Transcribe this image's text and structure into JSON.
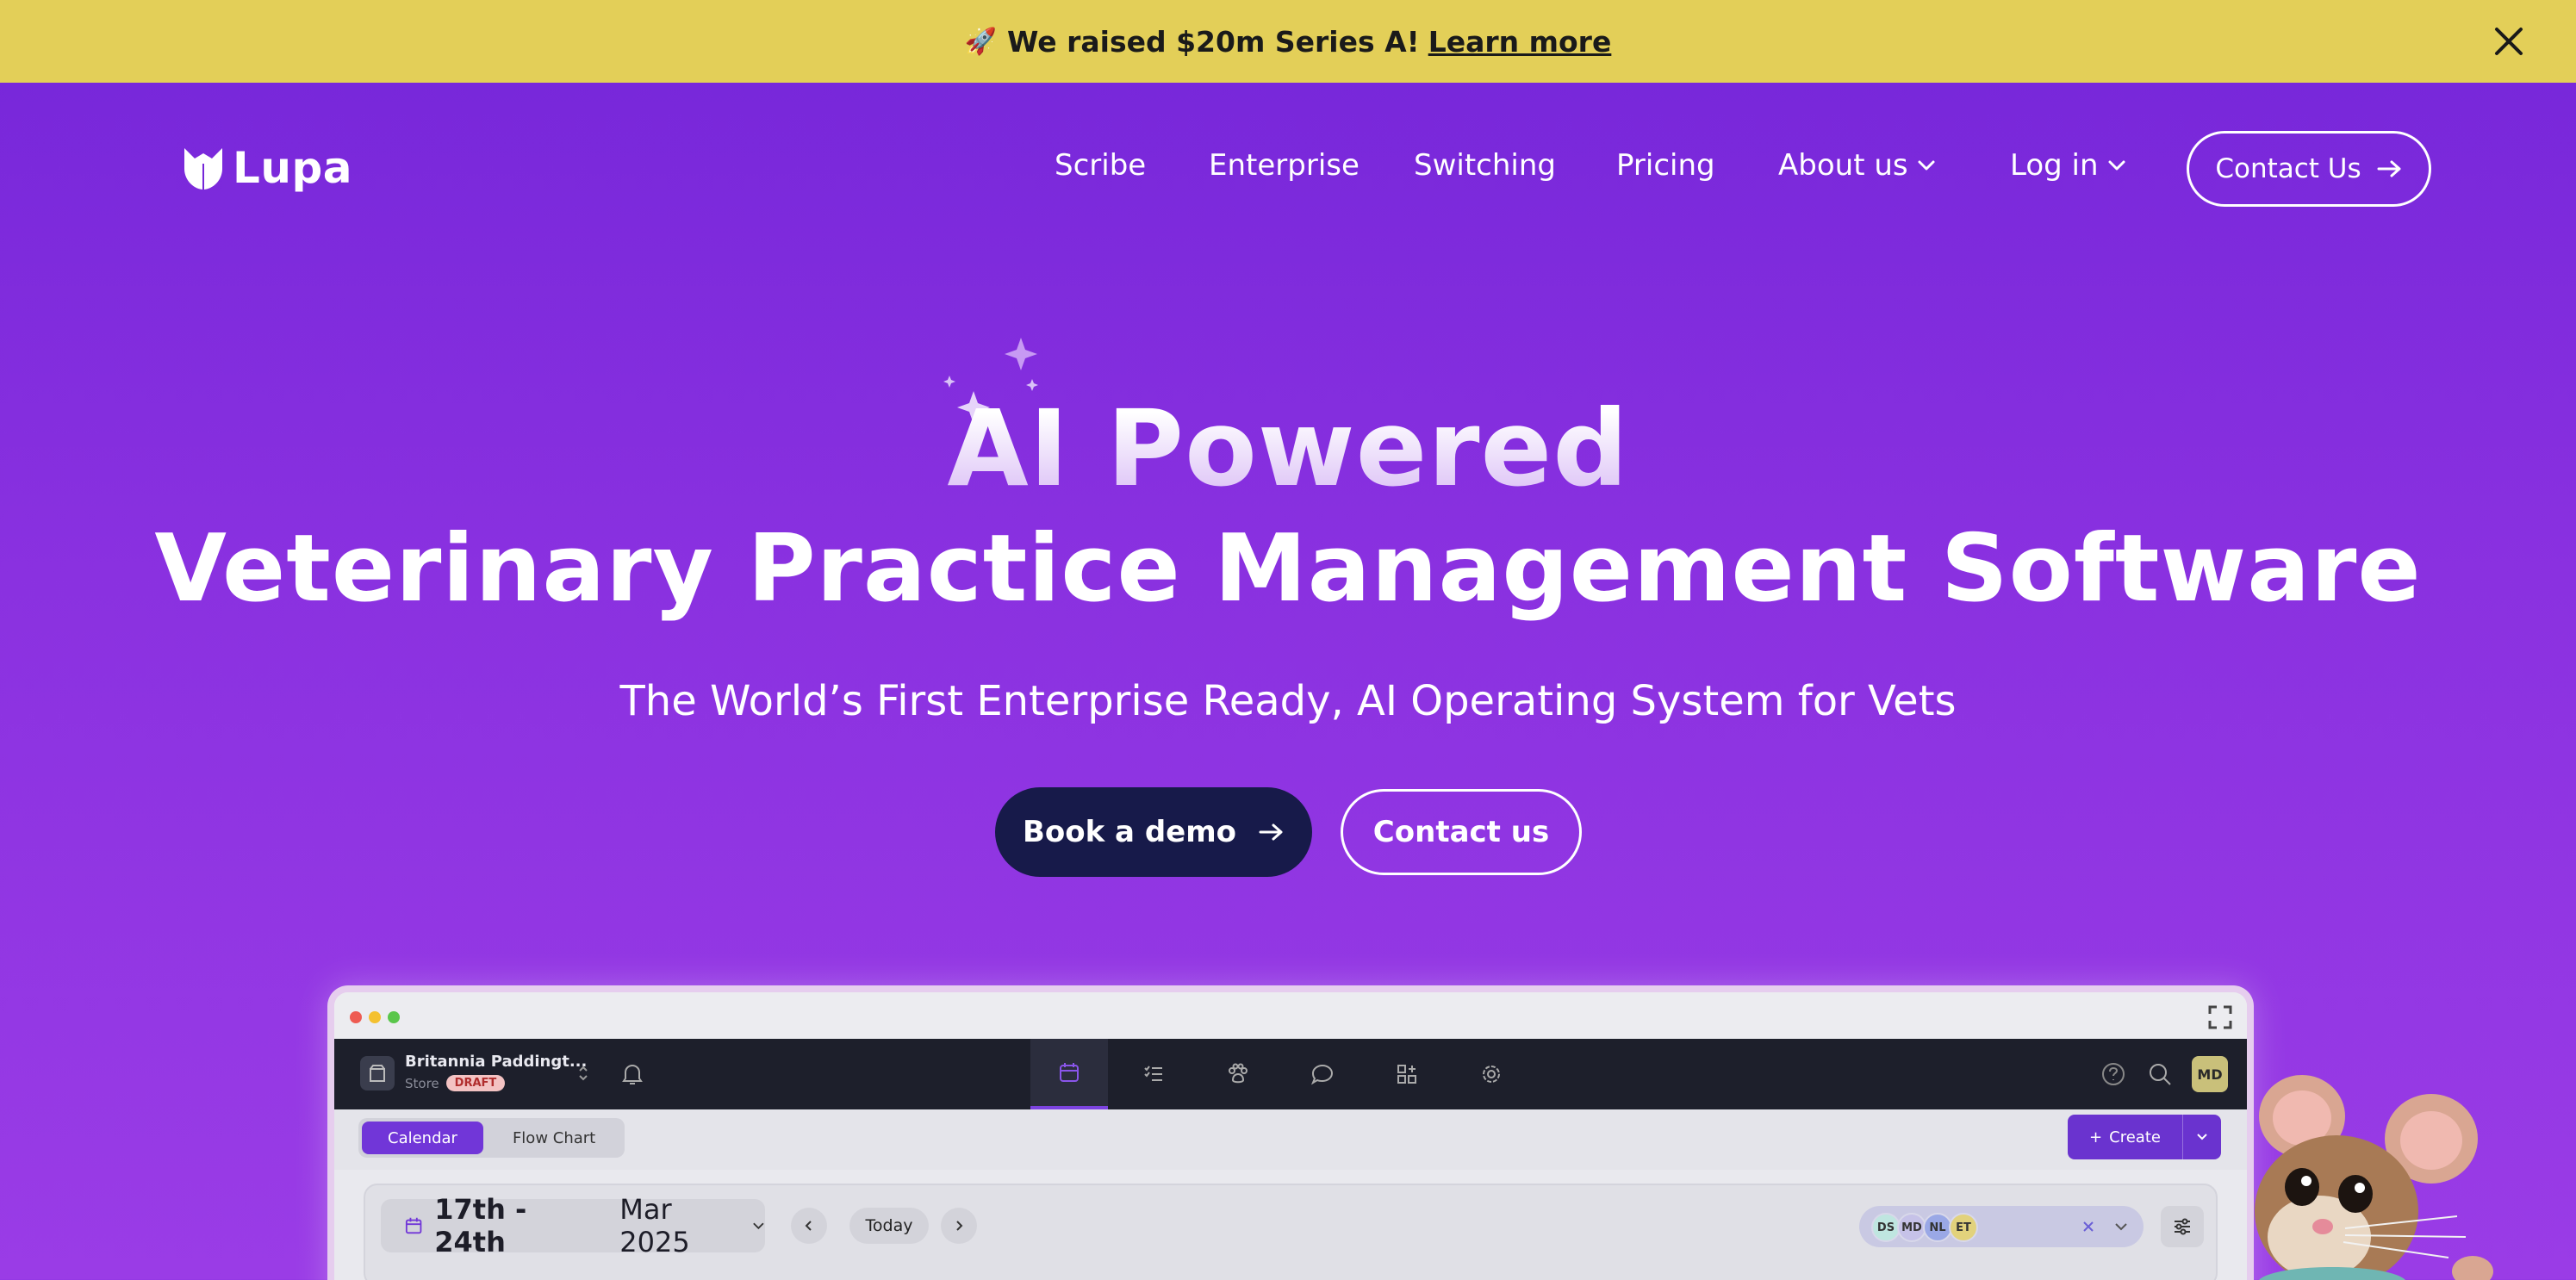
{
  "banner": {
    "emoji": "🚀",
    "text": "We raised $20m Series A!",
    "link": "Learn more"
  },
  "nav": {
    "logo": "Lupa",
    "items": [
      {
        "label": "Scribe"
      },
      {
        "label": "Enterprise"
      },
      {
        "label": "Switching"
      },
      {
        "label": "Pricing"
      },
      {
        "label": "About us"
      },
      {
        "label": "Log in"
      }
    ],
    "contact": "Contact Us"
  },
  "hero": {
    "line1": "AI Powered",
    "line2": "Veterinary Practice Management Software",
    "subtitle": "The World’s First Enterprise Ready, AI Operating System for Vets",
    "cta_primary": "Book a demo",
    "cta_secondary": "Contact us"
  },
  "app": {
    "store_name": "Britannia Paddingt...",
    "store_type": "Store",
    "store_status": "DRAFT",
    "nav_icons": [
      "calendar-icon",
      "checklist-icon",
      "paw-icon",
      "chat-icon",
      "apps-icon",
      "settings-icon"
    ],
    "user_initials": "MD",
    "view_tabs": [
      "Calendar",
      "Flow Chart"
    ],
    "create_label": "Create",
    "date_range": "17th - 24th",
    "date_month": "Mar 2025",
    "today_label": "Today",
    "staff": [
      {
        "initials": "DS",
        "color": "#bfe6e0"
      },
      {
        "initials": "MD",
        "color": "#c6c2e8"
      },
      {
        "initials": "NL",
        "color": "#9aa8e6"
      },
      {
        "initials": "ET",
        "color": "#e2d27c"
      }
    ]
  },
  "colors": {
    "banner_bg": "#e3cf58",
    "hero_bg_top": "#7526d9",
    "hero_bg_bottom": "#9a3ce6",
    "demo_button": "#171a4a",
    "app_accent": "#7136d8"
  }
}
